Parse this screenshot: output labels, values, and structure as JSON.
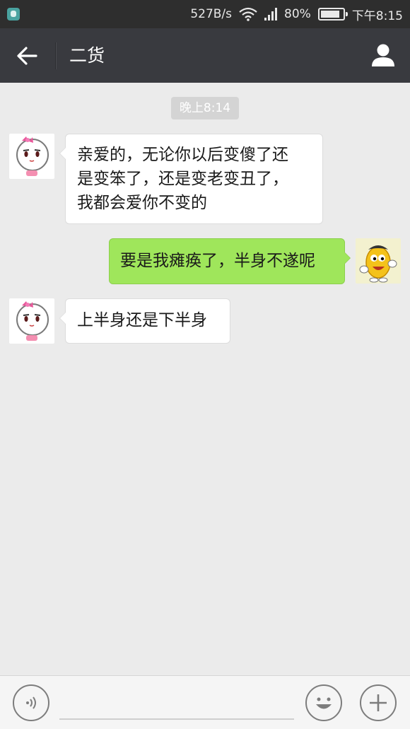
{
  "status_bar": {
    "net_speed": "527B/s",
    "battery_percent": "80%",
    "battery_level": 0.8,
    "time": "下午8:15",
    "icons": [
      "app-icon",
      "wifi-icon",
      "signal-icon",
      "battery-icon"
    ]
  },
  "header": {
    "title": "二货",
    "back_icon": "arrow-left-icon",
    "profile_icon": "person-icon"
  },
  "chat": {
    "timestamp": "晚上8:14",
    "messages": [
      {
        "side": "left",
        "text_lines": [
          "亲爱的，无论你以后变傻了还",
          "是变笨了，还是变老变丑了，",
          "我都会爱你不变的"
        ]
      },
      {
        "side": "right",
        "text": "要是我瘫痪了，半身不遂呢"
      },
      {
        "side": "left",
        "text": "上半身还是下半身"
      }
    ]
  },
  "input_bar": {
    "voice_icon": "voice-icon",
    "emoji_icon": "emoji-icon",
    "more_icon": "plus-icon",
    "input_value": ""
  },
  "colors": {
    "header_bg": "#393a3f",
    "status_bg": "#2e2e2e",
    "chat_bg": "#ebebeb",
    "bubble_right": "#9fe65b",
    "bubble_left": "#ffffff"
  }
}
